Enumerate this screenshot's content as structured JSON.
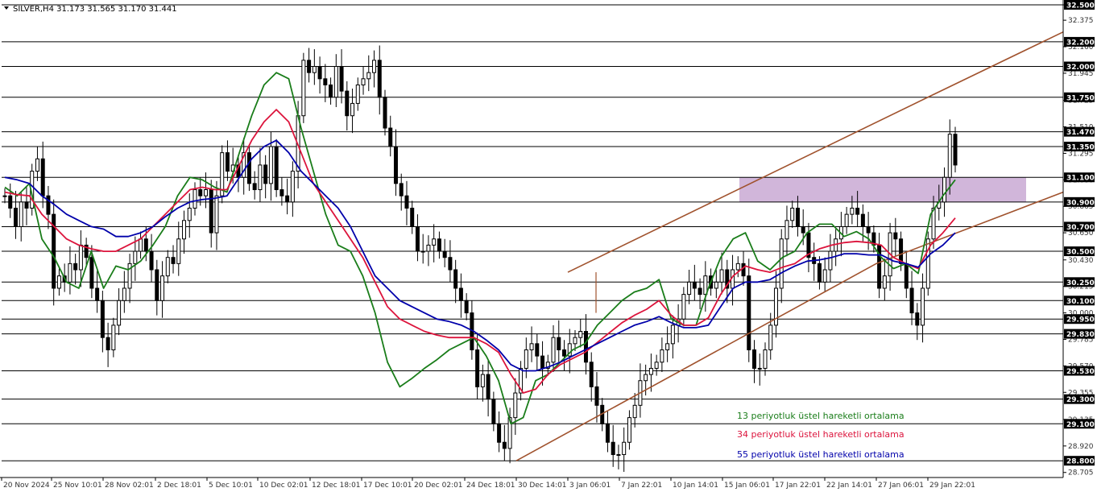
{
  "header": {
    "menu_icon": "triangle-down-icon",
    "text": "SILVER,H4  31.173 31.565 31.170 31.441"
  },
  "chart_data": {
    "type": "candlestick",
    "symbol": "SILVER",
    "timeframe": "H4",
    "ohlc_header": {
      "open": 31.173,
      "high": 31.565,
      "low": 31.17,
      "close": 31.441
    },
    "ylim": [
      28.7,
      32.5
    ],
    "y_axis_ticks": [
      "32.500",
      "32.375",
      "32.160",
      "31.945",
      "31.725",
      "31.510",
      "31.295",
      "31.080",
      "30.865",
      "30.650",
      "30.430",
      "30.215",
      "30.000",
      "29.785",
      "29.570",
      "29.355",
      "29.135",
      "28.920",
      "28.705"
    ],
    "x_axis_ticks": [
      "20 Nov 2024",
      "25 Nov 10:01",
      "28 Nov 02:01",
      "2 Dec 18:01",
      "5 Dec 10:01",
      "10 Dec 02:01",
      "12 Dec 18:01",
      "17 Dec 10:01",
      "20 Dec 02:01",
      "24 Dec 18:01",
      "30 Dec 14:01",
      "3 Jan 06:01",
      "7 Jan 22:01",
      "10 Jan 14:01",
      "15 Jan 06:01",
      "17 Jan 22:01",
      "22 Jan 14:01",
      "27 Jan 06:01",
      "29 Jan 22:01"
    ],
    "horizontal_levels": [
      {
        "value": 32.5,
        "label": "32.500"
      },
      {
        "value": 32.2,
        "label": "32.200"
      },
      {
        "value": 32.0,
        "label": "32.000"
      },
      {
        "value": 31.75,
        "label": "31.750"
      },
      {
        "value": 31.47,
        "label": "31.470"
      },
      {
        "value": 31.35,
        "label": "31.350"
      },
      {
        "value": 31.1,
        "label": "31.100"
      },
      {
        "value": 30.9,
        "label": "30.900"
      },
      {
        "value": 30.7,
        "label": "30.700"
      },
      {
        "value": 30.5,
        "label": "30.500"
      },
      {
        "value": 30.25,
        "label": "30.250"
      },
      {
        "value": 30.1,
        "label": "30.100"
      },
      {
        "value": 29.95,
        "label": "29.950"
      },
      {
        "value": 29.83,
        "label": "29.830"
      },
      {
        "value": 29.53,
        "label": "29.530"
      },
      {
        "value": 29.3,
        "label": "29.300"
      },
      {
        "value": 29.1,
        "label": "29.100"
      },
      {
        "value": 28.8,
        "label": "28.800"
      }
    ],
    "resistance_zone": {
      "from": 30.9,
      "to": 31.1,
      "color": "#c9a9d3"
    },
    "channel_lines": [
      {
        "name": "upper",
        "points": [
          [
            "3 Jan 06:01",
            30.33
          ],
          [
            "29 Jan 22:01",
            31.75
          ],
          [
            "end",
            32.28
          ]
        ]
      },
      {
        "name": "lower",
        "points": [
          [
            "30 Dec 14:01",
            28.8
          ],
          [
            "27 Jan 06:01",
            30.4
          ],
          [
            "end",
            30.98
          ]
        ]
      }
    ],
    "channel_color": "#a0522d",
    "series": [
      {
        "name": "13 periyotluk üstel hareketli ortalama",
        "color": "#1a7d1a",
        "values": [
          31.02,
          30.95,
          31.05,
          30.6,
          30.45,
          30.25,
          30.2,
          30.5,
          30.2,
          30.38,
          30.35,
          30.42,
          30.55,
          30.7,
          30.95,
          31.1,
          31.08,
          31.02,
          30.98,
          31.3,
          31.6,
          31.85,
          31.95,
          31.9,
          31.5,
          31.15,
          30.8,
          30.55,
          30.5,
          30.3,
          30.0,
          29.6,
          29.4,
          29.47,
          29.55,
          29.62,
          29.7,
          29.75,
          29.8,
          29.65,
          29.45,
          29.1,
          29.15,
          29.45,
          29.5,
          29.6,
          29.7,
          29.75,
          29.9,
          30.0,
          30.1,
          30.17,
          30.2,
          30.27,
          29.95,
          29.9,
          29.9,
          30.2,
          30.45,
          30.6,
          30.65,
          30.42,
          30.35,
          30.45,
          30.5,
          30.65,
          30.72,
          30.72,
          30.62,
          30.66,
          30.6,
          30.45,
          30.36,
          30.4,
          30.32,
          30.8,
          30.95,
          31.08
        ]
      },
      {
        "name": "34 periyotluk üstel hareketli ortalama",
        "color": "#dc143c",
        "values": [
          30.98,
          30.96,
          30.95,
          30.8,
          30.7,
          30.6,
          30.55,
          30.52,
          30.5,
          30.5,
          30.55,
          30.6,
          30.7,
          30.8,
          30.9,
          31.0,
          31.02,
          31.0,
          31.0,
          31.2,
          31.4,
          31.55,
          31.65,
          31.55,
          31.3,
          31.05,
          30.9,
          30.75,
          30.6,
          30.45,
          30.25,
          30.05,
          29.95,
          29.9,
          29.85,
          29.82,
          29.8,
          29.8,
          29.8,
          29.75,
          29.68,
          29.5,
          29.35,
          29.38,
          29.5,
          29.58,
          29.63,
          29.68,
          29.76,
          29.84,
          29.92,
          29.98,
          30.03,
          30.1,
          29.98,
          29.9,
          29.9,
          29.96,
          30.15,
          30.3,
          30.38,
          30.35,
          30.33,
          30.37,
          30.4,
          30.47,
          30.52,
          30.55,
          30.57,
          30.58,
          30.57,
          30.55,
          30.45,
          30.4,
          30.36,
          30.55,
          30.65,
          30.77
        ]
      },
      {
        "name": "55 periyotluk üstel hareketli ortalama",
        "color": "#0000aa",
        "values": [
          31.1,
          31.08,
          31.05,
          30.95,
          30.88,
          30.8,
          30.75,
          30.7,
          30.68,
          30.62,
          30.62,
          30.65,
          30.7,
          30.78,
          30.85,
          30.9,
          30.92,
          30.93,
          30.95,
          31.1,
          31.25,
          31.35,
          31.4,
          31.3,
          31.15,
          31.05,
          30.95,
          30.85,
          30.7,
          30.5,
          30.3,
          30.2,
          30.1,
          30.05,
          30.0,
          29.95,
          29.93,
          29.9,
          29.85,
          29.78,
          29.7,
          29.58,
          29.53,
          29.53,
          29.56,
          29.6,
          29.65,
          29.7,
          29.75,
          29.8,
          29.85,
          29.9,
          29.93,
          29.97,
          29.92,
          29.88,
          29.88,
          29.9,
          30.05,
          30.2,
          30.25,
          30.25,
          30.27,
          30.33,
          30.38,
          30.42,
          30.43,
          30.45,
          30.48,
          30.48,
          30.47,
          30.47,
          30.42,
          30.4,
          30.37,
          30.48,
          30.55,
          30.65
        ]
      }
    ],
    "candles_close": [
      30.95,
      30.85,
      30.7,
      30.9,
      30.85,
      31.15,
      31.25,
      30.95,
      30.8,
      30.2,
      30.3,
      30.25,
      30.4,
      30.35,
      30.55,
      30.45,
      30.2,
      30.1,
      29.8,
      29.7,
      29.9,
      30.1,
      30.2,
      30.4,
      30.5,
      30.6,
      30.5,
      30.35,
      30.1,
      30.3,
      30.45,
      30.4,
      30.6,
      30.75,
      30.85,
      31.0,
      30.95,
      31.0,
      30.65,
      30.95,
      31.3,
      31.15,
      31.2,
      31.1,
      31.3,
      31.05,
      31.0,
      31.2,
      31.05,
      31.35,
      31.0,
      30.95,
      30.9,
      31.15,
      31.6,
      32.05,
      31.95,
      32.0,
      31.9,
      31.85,
      31.75,
      32.0,
      31.8,
      31.6,
      31.7,
      31.85,
      31.9,
      31.95,
      32.05,
      31.75,
      31.5,
      31.35,
      31.05,
      30.95,
      30.85,
      30.7,
      30.5,
      30.5,
      30.55,
      30.6,
      30.5,
      30.45,
      30.35,
      30.2,
      30.1,
      30.0,
      29.7,
      29.4,
      29.5,
      29.3,
      29.1,
      28.95,
      28.9,
      29.15,
      29.35,
      29.55,
      29.7,
      29.75,
      29.65,
      29.55,
      29.6,
      29.8,
      29.7,
      29.65,
      29.75,
      29.8,
      29.85,
      29.6,
      29.4,
      29.25,
      29.1,
      28.95,
      28.85,
      28.85,
      28.95,
      29.15,
      29.25,
      29.45,
      29.5,
      29.55,
      29.6,
      29.7,
      29.75,
      29.9,
      29.95,
      30.15,
      30.25,
      30.2,
      30.15,
      30.3,
      30.2,
      30.25,
      30.35,
      30.2,
      30.35,
      30.4,
      30.3,
      29.7,
      29.55,
      29.55,
      29.7,
      29.9,
      30.2,
      30.6,
      30.75,
      30.85,
      30.7,
      30.65,
      30.45,
      30.4,
      30.25,
      30.35,
      30.5,
      30.6,
      30.7,
      30.8,
      30.85,
      30.8,
      30.7,
      30.65,
      30.55,
      30.2,
      30.3,
      30.65,
      30.6,
      30.4,
      30.2,
      30.0,
      29.9,
      30.2,
      30.6,
      30.85,
      30.9,
      31.1,
      31.45,
      31.2
    ]
  },
  "legend": {
    "ema13": "13 periyotluk üstel hareketli ortalama",
    "ema34": "34 periyotluk üstel hareketli ortalama",
    "ema55": "55 periyotluk üstel hareketli ortalama"
  }
}
